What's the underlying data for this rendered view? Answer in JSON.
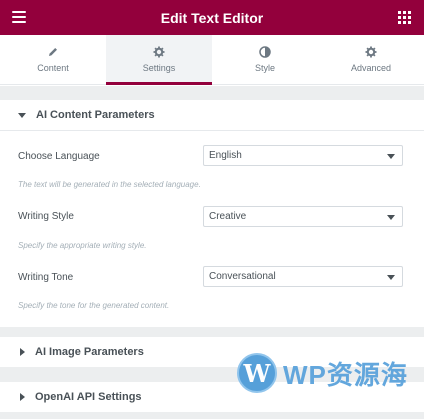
{
  "header": {
    "title": "Edit Text Editor"
  },
  "tabs": [
    {
      "label": "Content",
      "icon": "pencil-icon"
    },
    {
      "label": "Settings",
      "icon": "gear-icon"
    },
    {
      "label": "Style",
      "icon": "half-circle-icon"
    },
    {
      "label": "Advanced",
      "icon": "gear-icon"
    }
  ],
  "active_tab": "Settings",
  "sections": [
    {
      "title": "AI Content Parameters",
      "expanded": true
    },
    {
      "title": "AI Image Parameters",
      "expanded": false
    },
    {
      "title": "OpenAI API Settings",
      "expanded": false
    }
  ],
  "fields": [
    {
      "label": "Choose Language",
      "value": "English",
      "description": "The text will be generated in the selected language."
    },
    {
      "label": "Writing Style",
      "value": "Creative",
      "description": "Specify the appropriate writing style."
    },
    {
      "label": "Writing Tone",
      "value": "Conversational",
      "description": "Specify the tone for the generated content."
    }
  ],
  "watermark": {
    "logo_letter": "W",
    "text": "WP资源海"
  },
  "colors": {
    "brand": "#93003c",
    "panel_gap": "#eceeef",
    "watermark": "#5ba3dc"
  }
}
